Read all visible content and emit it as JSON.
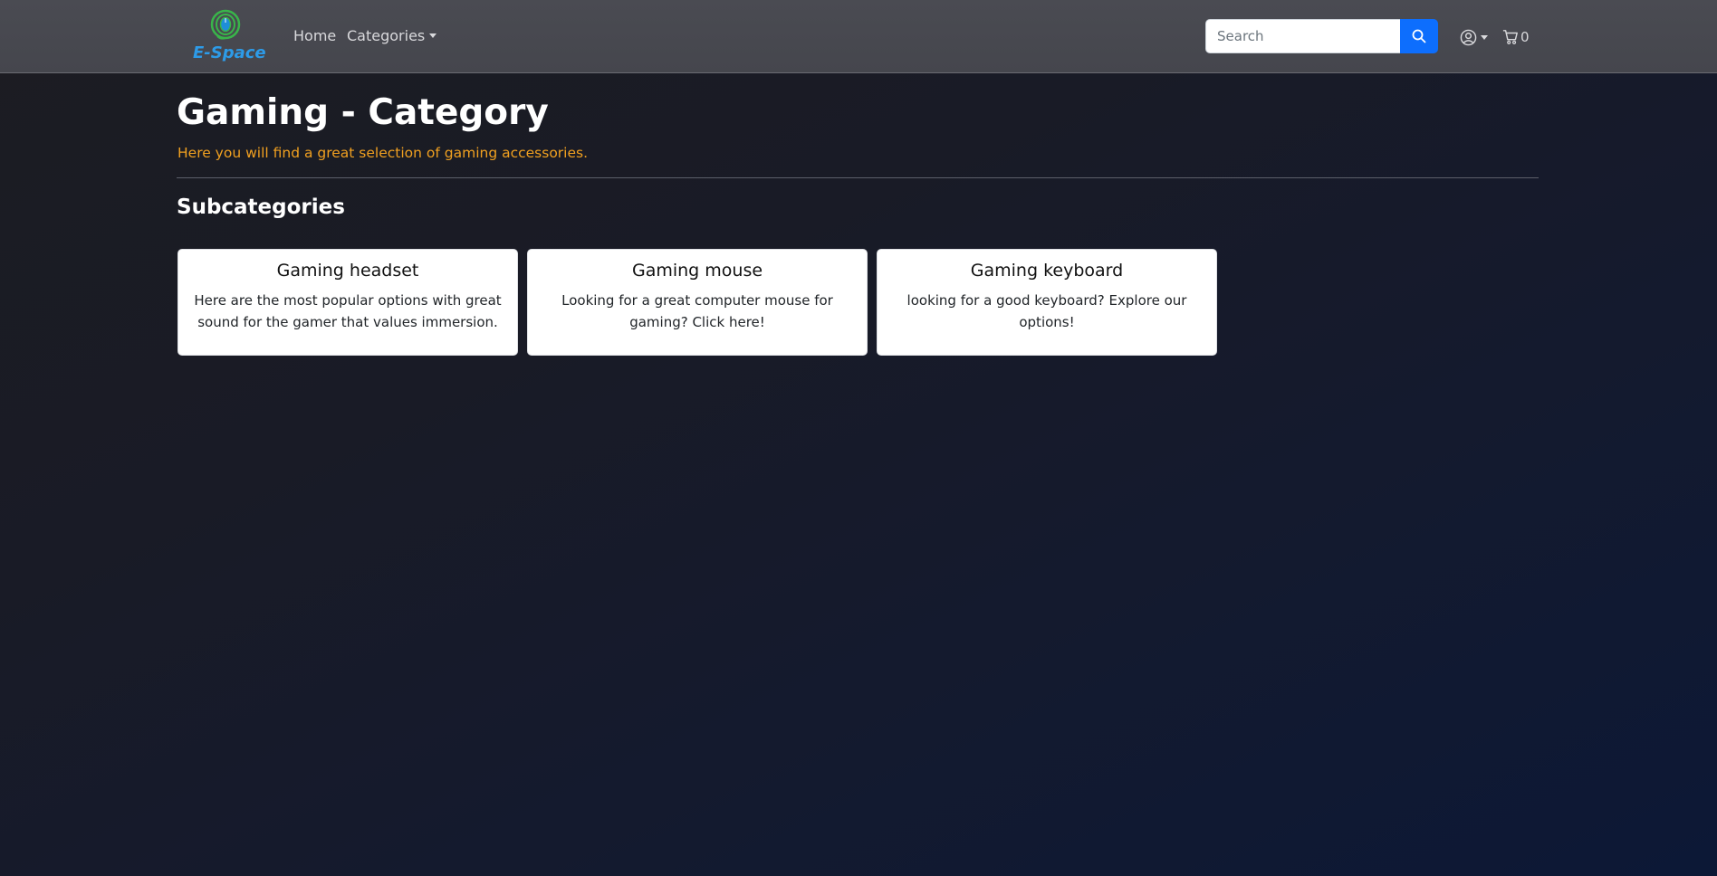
{
  "brand": {
    "name": "E-Space",
    "color": "#2d9be8"
  },
  "nav": {
    "home_label": "Home",
    "categories_label": "Categories"
  },
  "search": {
    "placeholder": "Search",
    "button_icon": "search-icon"
  },
  "cart": {
    "count": "0",
    "icon": "cart-icon"
  },
  "account": {
    "icon": "user-circle-icon"
  },
  "page": {
    "title": "Gaming - Category",
    "subtitle": "Here you will find a great selection of gaming accessories.",
    "subtitle_color": "#f0a020"
  },
  "subcategories": {
    "heading": "Subcategories",
    "items": [
      {
        "title": "Gaming headset",
        "description": "Here are the most popular options with great sound for the gamer that values immersion."
      },
      {
        "title": "Gaming mouse",
        "description": "Looking for a great computer mouse for gaming? Click here!"
      },
      {
        "title": "Gaming keyboard",
        "description": "looking for a good keyboard? Explore our options!"
      }
    ]
  },
  "colors": {
    "primary_button": "#0d6efd",
    "navbar": "#48494f"
  }
}
